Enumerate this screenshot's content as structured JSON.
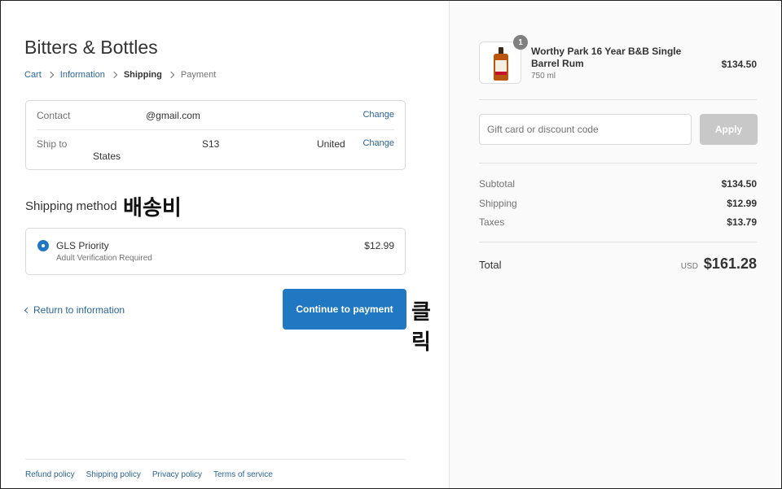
{
  "shop": {
    "title": "Bitters & Bottles"
  },
  "breadcrumb": [
    "Cart",
    "Information",
    "Shipping",
    "Payment"
  ],
  "review": {
    "contact_label": "Contact",
    "contact_value": "@gmail.com",
    "shipto_label": "Ship to",
    "shipto_line1": "S13",
    "shipto_line2": "United",
    "shipto_line3": "States",
    "change_label": "Change"
  },
  "shipping_method": {
    "title": "Shipping method",
    "option_name": "GLS Priority",
    "option_sub": "Adult Verification Required",
    "option_price": "$12.99",
    "selected": true
  },
  "annotations": {
    "shipping": "배송비",
    "click": "클릭"
  },
  "actions": {
    "return_label": "Return to information",
    "continue_label": "Continue to payment"
  },
  "footer": [
    "Refund policy",
    "Shipping policy",
    "Privacy policy",
    "Terms of service"
  ],
  "summary": {
    "product_name": "Worthy Park 16 Year B&B Single Barrel Rum",
    "product_variant": "750 ml",
    "product_price": "$134.50",
    "quantity": "1",
    "discount_placeholder": "Gift card or discount code",
    "apply_label": "Apply",
    "subtotal_label": "Subtotal",
    "subtotal_value": "$134.50",
    "shipping_label": "Shipping",
    "shipping_value": "$12.99",
    "taxes_label": "Taxes",
    "taxes_value": "$13.79",
    "total_label": "Total",
    "total_currency": "USD",
    "total_value": "$161.28"
  },
  "colors": {
    "accent": "#1f78c1",
    "link": "#2a6496",
    "muted": "#737373"
  }
}
